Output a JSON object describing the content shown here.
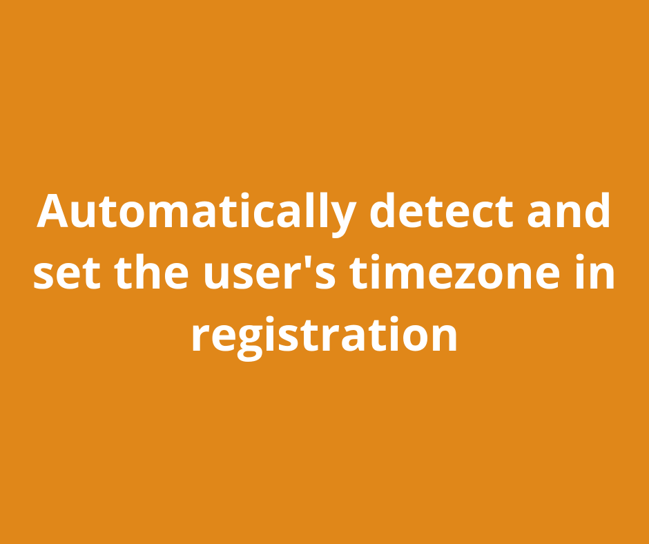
{
  "heading": "Automatically detect and set the user's timezone in registration",
  "background_color": "#e08719",
  "text_color": "#ffffff"
}
